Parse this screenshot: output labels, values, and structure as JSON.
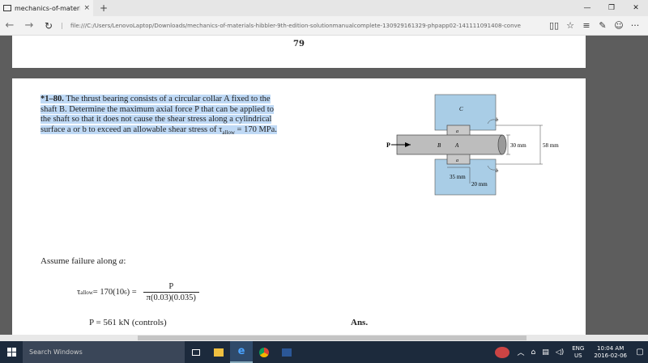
{
  "browser": {
    "tab_title": "mechanics-of-materials-",
    "tab_close": "×",
    "new_tab": "+",
    "win_min": "—",
    "win_max": "❐",
    "win_close": "✕",
    "back": "←",
    "forward": "→",
    "refresh": "↻",
    "url": "file:///C:/Users/LenovoLaptop/Downloads/mechanics-of-materials-hibbler-9th-edition-solutionmanualcomplete-130929161329-phpapp02-141111091408-conve",
    "reading_view": "▯▯",
    "favorite": "☆",
    "hub": "≡",
    "note": "✎",
    "share": "☺",
    "more": "···"
  },
  "document": {
    "page_number": "79",
    "problem_number": "*1–80.",
    "problem_text": "The thrust bearing consists of a circular collar A fixed to the shaft B. Determine the maximum axial force P that can be applied to the shaft so that it does not cause the shear stress along a cylindrical surface a or b to exceed an allowable shear stress of",
    "problem_tau": "τ",
    "problem_sub": "allow",
    "problem_value": " = 170 MPa.",
    "figure": {
      "label_P": "P",
      "label_B": "B",
      "label_A": "A",
      "label_C": "C",
      "label_a_top": "a",
      "label_a_bot": "a",
      "label_b_top": "b",
      "label_b_bot": "b",
      "dim_30": "30 mm",
      "dim_58": "58 mm",
      "dim_35": "35 mm",
      "dim_20": "20 mm"
    },
    "assume_prefix": "Assume failure along ",
    "assume_var": "a",
    "assume_suffix": ":",
    "eq1_tau": "τ",
    "eq1_sub": "allow",
    "eq1_mid": " = 170(10",
    "eq1_exp": "6",
    "eq1_close": ") =",
    "eq1_num": "P",
    "eq1_den": "π(0.03)(0.035)",
    "eq2": "P = 561 kN (controls)",
    "ans": "Ans."
  },
  "taskbar": {
    "search_placeholder": "Search Windows",
    "lang_top": "ENG",
    "lang_bottom": "US",
    "time": "10:04 AM",
    "date": "2016-02-06",
    "tray_up": "︿",
    "tray_net": "⌂",
    "tray_msg": "▤",
    "tray_vol": "◁)",
    "notifications": "▢"
  }
}
